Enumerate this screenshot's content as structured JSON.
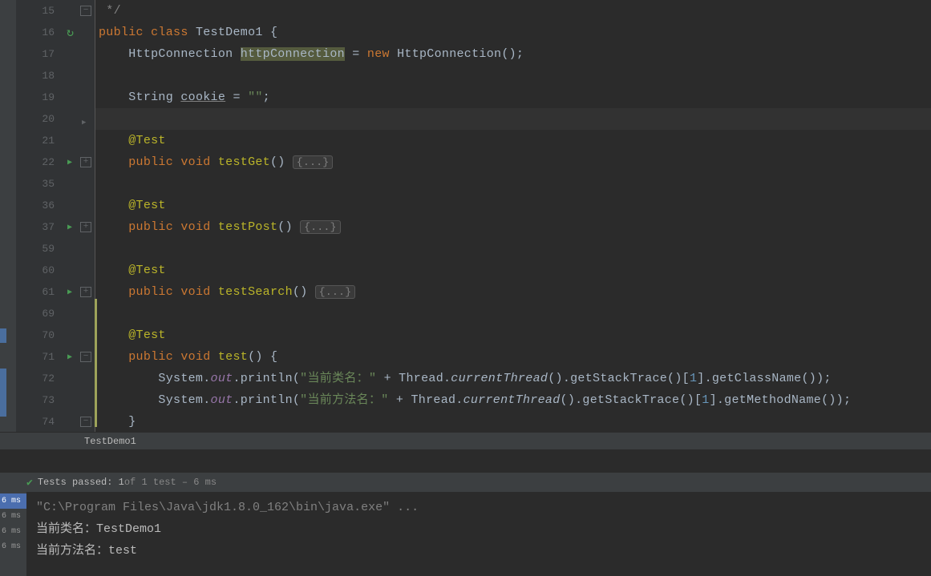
{
  "gutter": {
    "lines": [
      "15",
      "16",
      "17",
      "18",
      "19",
      "20",
      "21",
      "22",
      "35",
      "36",
      "37",
      "59",
      "60",
      "61",
      "69",
      "70",
      "71",
      "72",
      "73",
      "74"
    ]
  },
  "code": {
    "l15": " */",
    "l16_kw1": "public",
    "l16_kw2": "class",
    "l16_name": "TestDemo1",
    "l16_brace": " {",
    "l17_type": "HttpConnection ",
    "l17_var": "httpConnection",
    "l17_eq": " = ",
    "l17_new": "new",
    "l17_rest": " HttpConnection();",
    "l19_type": "String ",
    "l19_var": "cookie",
    "l19_eq": " = ",
    "l19_str": "\"\"",
    "l19_semi": ";",
    "ann": "@Test",
    "pub": "public",
    "void": "void",
    "m1": "testGet",
    "m2": "testPost",
    "m3": "testSearch",
    "m4": "test",
    "paren_fold": "() ",
    "fold_body": "{...}",
    "open": "() {",
    "l72_a": "System.",
    "l72_out": "out",
    "l72_b": ".println(",
    "l72_s": "\"当前类名：\"",
    "l72_c": " + Thread.",
    "l72_ct": "currentThread",
    "l72_d": "().getStackTrace()[",
    "l72_n": "1",
    "l72_e": "].getClassName());",
    "l73_a": "System.",
    "l73_out": "out",
    "l73_b": ".println(",
    "l73_s": "\"当前方法名：\"",
    "l73_c": " + Thread.",
    "l73_ct": "currentThread",
    "l73_d": "().getStackTrace()[",
    "l73_n": "1",
    "l73_e": "].getMethodName());",
    "l74": "}"
  },
  "breadcrumb": "TestDemo1",
  "testbar": {
    "label": "Tests passed: 1",
    "muted": " of 1 test – 6 ms"
  },
  "times": [
    "6 ms",
    "6 ms",
    "6 ms",
    "6 ms"
  ],
  "console": {
    "jvm": "\"C:\\Program Files\\Java\\jdk1.8.0_162\\bin\\java.exe\" ...",
    "line1": "当前类名：TestDemo1",
    "line2": "当前方法名：test"
  }
}
